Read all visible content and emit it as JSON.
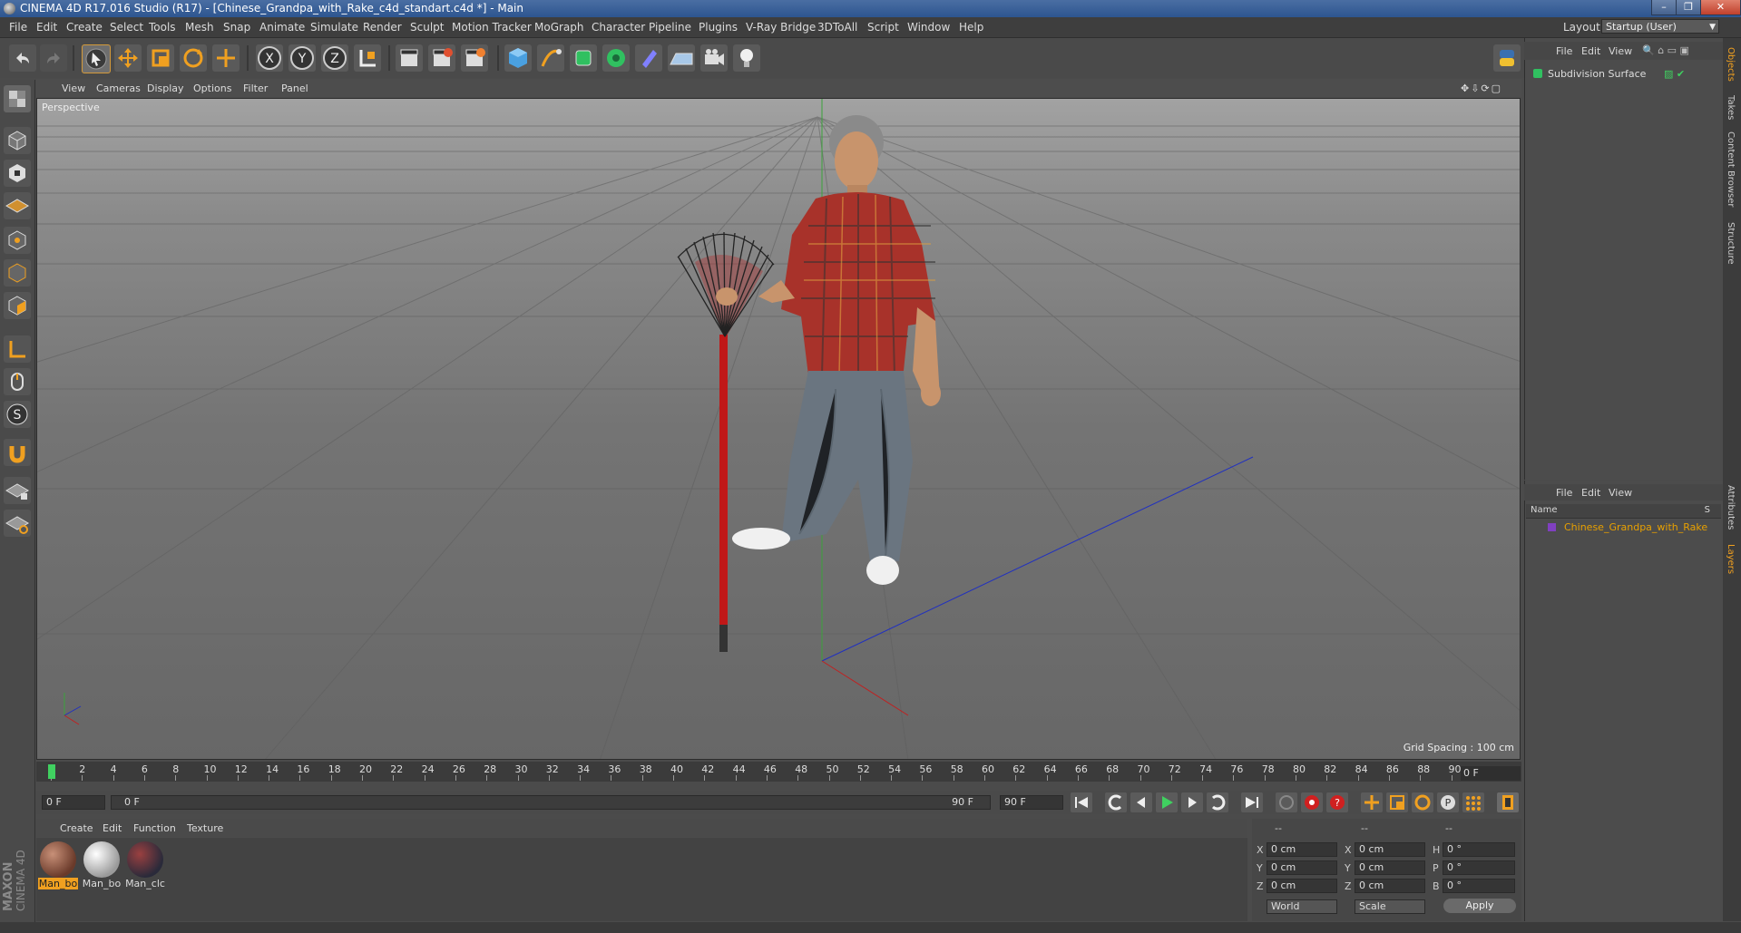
{
  "window": {
    "title": "CINEMA 4D R17.016 Studio (R17) - [Chinese_Grandpa_with_Rake_c4d_standart.c4d *] - Main",
    "min": "–",
    "max": "❐",
    "close": "✕"
  },
  "menu": [
    "File",
    "Edit",
    "Create",
    "Select",
    "Tools",
    "Mesh",
    "Snap",
    "Animate",
    "Simulate",
    "Render",
    "Sculpt",
    "Motion Tracker",
    "MoGraph",
    "Character",
    "Pipeline",
    "Plugins",
    "V-Ray Bridge",
    "3DToAll",
    "Script",
    "Window",
    "Help"
  ],
  "layout": {
    "label": "Layout:",
    "value": "Startup (User)"
  },
  "viewport": {
    "menu": [
      "View",
      "Cameras",
      "Display",
      "Options",
      "Filter",
      "Panel"
    ],
    "label": "Perspective",
    "grid_spacing": "Grid Spacing : 100 cm"
  },
  "timeline": {
    "ticks": [
      "0",
      "2",
      "4",
      "6",
      "8",
      "10",
      "12",
      "14",
      "16",
      "18",
      "20",
      "22",
      "24",
      "26",
      "28",
      "30",
      "32",
      "34",
      "36",
      "38",
      "40",
      "42",
      "44",
      "46",
      "48",
      "50",
      "52",
      "54",
      "56",
      "58",
      "60",
      "62",
      "64",
      "66",
      "68",
      "70",
      "72",
      "74",
      "76",
      "78",
      "80",
      "82",
      "84",
      "86",
      "88",
      "90"
    ],
    "current_frame": "0 F",
    "start_field": "0 F",
    "range_start": "0 F",
    "range_end": "90 F",
    "end_field": "90 F"
  },
  "materials": {
    "menu": [
      "Create",
      "Edit",
      "Function",
      "Texture"
    ],
    "items": [
      {
        "label": "Man_bo",
        "color": "#7a4a3a"
      },
      {
        "label": "Man_bo",
        "color": "#d8d8d8"
      },
      {
        "label": "Man_clc",
        "color": "#553333"
      }
    ]
  },
  "coords": {
    "headers": [
      "--",
      "--",
      "--"
    ],
    "rows": [
      {
        "a": "X",
        "av": "0 cm",
        "b": "X",
        "bv": "0 cm",
        "c": "H",
        "cv": "0 °"
      },
      {
        "a": "Y",
        "av": "0 cm",
        "b": "Y",
        "bv": "0 cm",
        "c": "P",
        "cv": "0 °"
      },
      {
        "a": "Z",
        "av": "0 cm",
        "b": "Z",
        "bv": "0 cm",
        "c": "B",
        "cv": "0 °"
      }
    ],
    "world": "World",
    "scale": "Scale",
    "apply": "Apply"
  },
  "objects_panel": {
    "menu": [
      "File",
      "Edit",
      "View"
    ],
    "items": [
      {
        "name": "Subdivision Surface"
      }
    ]
  },
  "layers_panel": {
    "menu": [
      "File",
      "Edit",
      "View"
    ],
    "col_name": "Name",
    "col_s": "S",
    "items": [
      {
        "name": "Chinese_Grandpa_with_Rake",
        "color": "#e8a000"
      }
    ]
  },
  "side_tabs": [
    "Objects",
    "Takes",
    "Content Browser",
    "Structure",
    "Attributes",
    "Layers"
  ],
  "brand": {
    "maxon": "MAXON",
    "product": "CINEMA 4D"
  },
  "colors": {
    "accent": "#e8a000",
    "selection": "#f0b030"
  }
}
